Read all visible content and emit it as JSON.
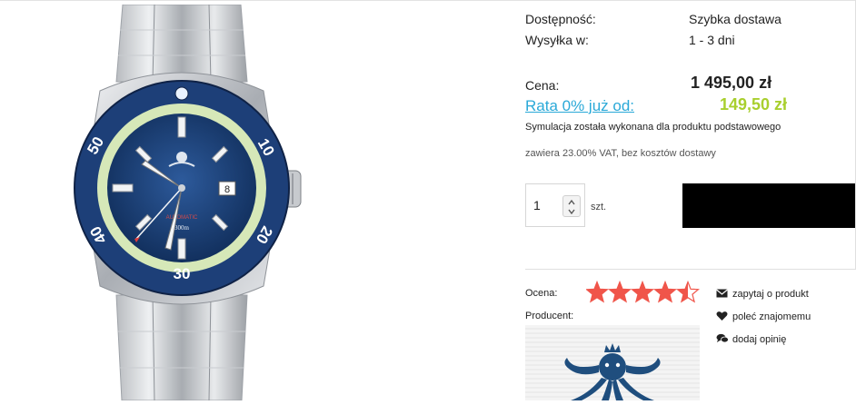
{
  "availability": {
    "label": "Dostępność:",
    "value": "Szybka dostawa"
  },
  "shipping": {
    "label": "Wysyłka w:",
    "value": "1 - 3 dni"
  },
  "price": {
    "label": "Cena:",
    "value": "1 495,00 zł"
  },
  "installment": {
    "link_text": "Rata 0% już od:",
    "value": "149,50 zł",
    "note": "Symulacja została wykonana dla produktu podstawowego"
  },
  "vat_note": "zawiera 23.00% VAT, bez kosztów dostawy",
  "quantity": {
    "value": "1",
    "unit": "szt."
  },
  "rating": {
    "label": "Ocena:",
    "stars": 4.5,
    "max": 5,
    "color": "#f0554a"
  },
  "producer": {
    "label": "Producent:"
  },
  "actions": {
    "ask": "zapytaj o produkt",
    "recommend": "poleć znajomemu",
    "review": "dodaj opinię"
  },
  "colors": {
    "installment_link": "#2aa9d8",
    "installment_value": "#a9cf2e",
    "dial_blue": "#1d3f78"
  }
}
